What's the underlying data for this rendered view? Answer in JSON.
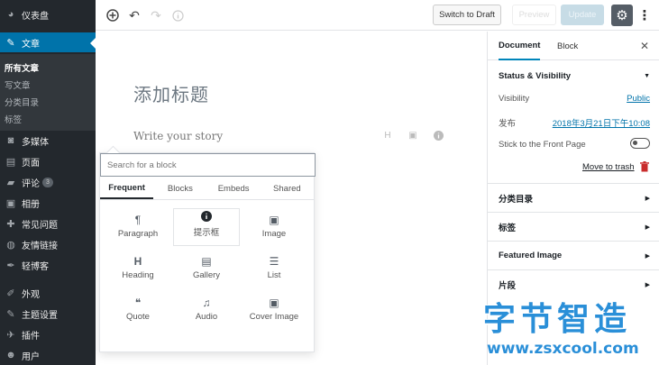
{
  "sidebar": {
    "items": [
      {
        "label": "仪表盘",
        "icon": "dashboard-icon"
      },
      {
        "label": "文章",
        "icon": "pin-icon"
      },
      {
        "label": "多媒体",
        "icon": "media-icon"
      },
      {
        "label": "页面",
        "icon": "page-icon"
      },
      {
        "label": "评论",
        "icon": "comment-icon",
        "badge": "3"
      },
      {
        "label": "相册",
        "icon": "gallery-icon"
      },
      {
        "label": "常见问题",
        "icon": "question-icon"
      },
      {
        "label": "友情链接",
        "icon": "globe-icon"
      },
      {
        "label": "轻博客",
        "icon": "feather-icon"
      },
      {
        "label": "外观",
        "icon": "brush-icon"
      },
      {
        "label": "主题设置",
        "icon": "settings-icon"
      },
      {
        "label": "插件",
        "icon": "plugin-icon"
      },
      {
        "label": "用户",
        "icon": "user-icon"
      }
    ],
    "submenu": [
      "所有文章",
      "写文章",
      "分类目录",
      "标签"
    ]
  },
  "toolbar": {
    "switch_to_draft": "Switch to Draft",
    "preview": "Preview",
    "update": "Update"
  },
  "editor": {
    "title": "添加标题",
    "story_placeholder": "Write your story"
  },
  "inserter": {
    "search_placeholder": "Search for a block",
    "tabs": [
      "Frequent",
      "Blocks",
      "Embeds",
      "Shared"
    ],
    "blocks": [
      {
        "label": "Paragraph",
        "glyph": "¶"
      },
      {
        "label": "提示框",
        "glyph": "ℹ"
      },
      {
        "label": "Image",
        "glyph": "▣"
      },
      {
        "label": "Heading",
        "glyph": "H"
      },
      {
        "label": "Gallery",
        "glyph": "▤"
      },
      {
        "label": "List",
        "glyph": "☰"
      },
      {
        "label": "Quote",
        "glyph": "❝"
      },
      {
        "label": "Audio",
        "glyph": "♫"
      },
      {
        "label": "Cover Image",
        "glyph": "▣"
      }
    ]
  },
  "panel": {
    "tab_document": "Document",
    "tab_block": "Block",
    "status_heading": "Status & Visibility",
    "visibility_label": "Visibility",
    "visibility_value": "Public",
    "publish_label": "发布",
    "publish_value": "2018年3月21日下午10:08",
    "sticky_label": "Stick to the Front Page",
    "trash_label": "Move to trash",
    "sections": [
      "分类目录",
      "标签",
      "Featured Image",
      "片段"
    ]
  },
  "watermark": {
    "title": "字节智造",
    "url": "www.zsxcool.com"
  },
  "colors": {
    "sidebar_bg": "#23282d",
    "sidebar_active": "#0073aa",
    "link": "#0073aa",
    "watermark": "#2a8fd8"
  }
}
